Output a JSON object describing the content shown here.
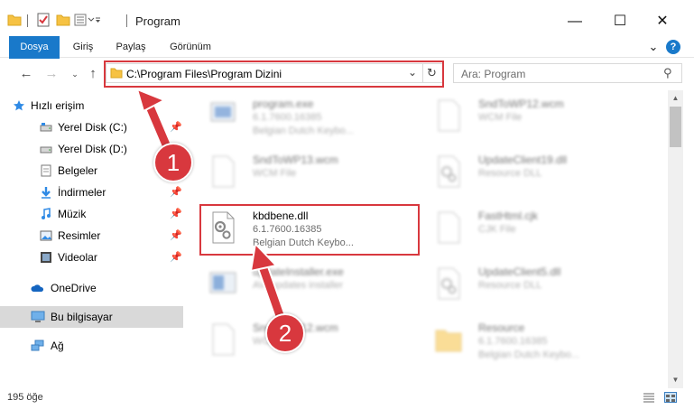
{
  "window": {
    "title": "Program",
    "minimize": "—",
    "maximize": "☐",
    "close": "✕"
  },
  "ribbon": {
    "tabs": [
      "Dosya",
      "Giriş",
      "Paylaş",
      "Görünüm"
    ],
    "expand": "⌄",
    "help": "?"
  },
  "address": {
    "path": "C:\\Program Files\\Program Dizini",
    "dropdown": "⌄",
    "refresh": "↻"
  },
  "search": {
    "placeholder": "Ara: Program",
    "icon": "⚲"
  },
  "sidebar": {
    "items": [
      {
        "label": "Hızlı erişim",
        "icon": "star-icon",
        "pinned": false
      },
      {
        "label": "Yerel Disk (C:)",
        "icon": "drive-icon",
        "pinned": true
      },
      {
        "label": "Yerel Disk (D:)",
        "icon": "drive-icon",
        "pinned": false
      },
      {
        "label": "Belgeler",
        "icon": "documents-icon",
        "pinned": true
      },
      {
        "label": "İndirmeler",
        "icon": "downloads-icon",
        "pinned": true
      },
      {
        "label": "Müzik",
        "icon": "music-icon",
        "pinned": true
      },
      {
        "label": "Resimler",
        "icon": "pictures-icon",
        "pinned": true
      },
      {
        "label": "Videolar",
        "icon": "videos-icon",
        "pinned": true
      },
      {
        "label": "OneDrive",
        "icon": "cloud-icon",
        "pinned": false
      },
      {
        "label": "Bu bilgisayar",
        "icon": "computer-icon",
        "pinned": false
      },
      {
        "label": "Ağ",
        "icon": "network-icon",
        "pinned": false
      }
    ]
  },
  "files": [
    {
      "name": "program.exe",
      "line2": "6.1.7600.16385",
      "line3": "Belgian Dutch Keybo...",
      "icon": "exe-icon"
    },
    {
      "name": "SndToWP12.wcm",
      "line2": "WCM File",
      "line3": "",
      "icon": "document-icon"
    },
    {
      "name": "SndToWP13.wcm",
      "line2": "WCM File",
      "line3": "",
      "icon": "document-icon"
    },
    {
      "name": "UpdateClient19.dll",
      "line2": "Resource DLL",
      "line3": "",
      "icon": "dll-icon"
    },
    {
      "name": "kbdbene.dll",
      "line2": "6.1.7600.16385",
      "line3": "Belgian Dutch Keybo...",
      "icon": "dll-icon"
    },
    {
      "name": "FastHtml.cjk",
      "line2": "CJK File",
      "line3": "",
      "icon": "document-icon"
    },
    {
      "name": "updateInstaller.exe",
      "line2": "AVI updates installer",
      "line3": "",
      "icon": "installer-icon"
    },
    {
      "name": "UpdateClient5.dll",
      "line2": "Resource DLL",
      "line3": "",
      "icon": "dll-icon"
    },
    {
      "name": "SndToWP12.wcm",
      "line2": "WCM File",
      "line3": "",
      "icon": "document-icon"
    },
    {
      "name": "Resource",
      "line2": "6.1.7600.16385",
      "line3": "Belgian Dutch Keybo...",
      "icon": "folder-icon"
    }
  ],
  "status": {
    "count": "195 öğe"
  },
  "annotations": {
    "step1": "1",
    "step2": "2"
  },
  "colors": {
    "accent": "#1979ca",
    "highlight": "#d8383e",
    "folder": "#f6c243"
  }
}
